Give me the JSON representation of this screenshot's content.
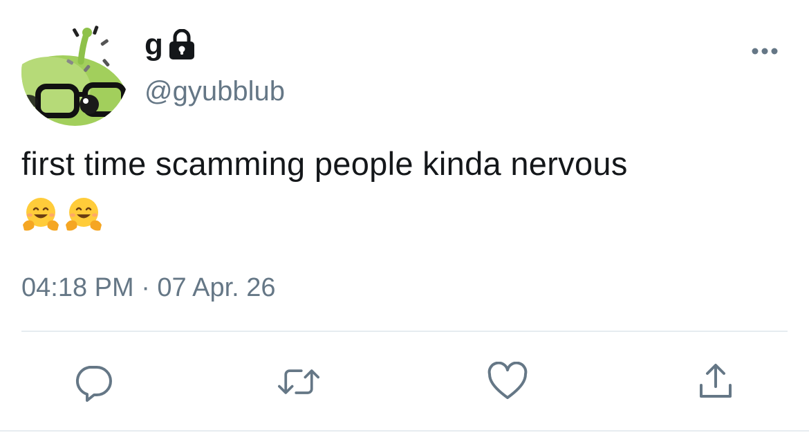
{
  "author": {
    "display_name": "g",
    "handle": "@gyubblub",
    "protected_icon": "lock-icon",
    "avatar_icon": "green-creature-with-glasses-avatar"
  },
  "tweet": {
    "text": "first time scamming people kinda nervous",
    "emojis": [
      "🤗",
      "🤗"
    ],
    "timestamp": "04:18 PM · 07 Apr. 26"
  },
  "actions": [
    {
      "name": "reply",
      "icon": "reply-icon"
    },
    {
      "name": "retweet",
      "icon": "retweet-icon"
    },
    {
      "name": "like",
      "icon": "heart-icon"
    },
    {
      "name": "share",
      "icon": "share-icon"
    }
  ],
  "menu_icon": "more-icon",
  "colors": {
    "text_primary": "#14171a",
    "text_secondary": "#657786",
    "divider": "#e6ecf0",
    "avatar_green": "#9ccd55"
  }
}
